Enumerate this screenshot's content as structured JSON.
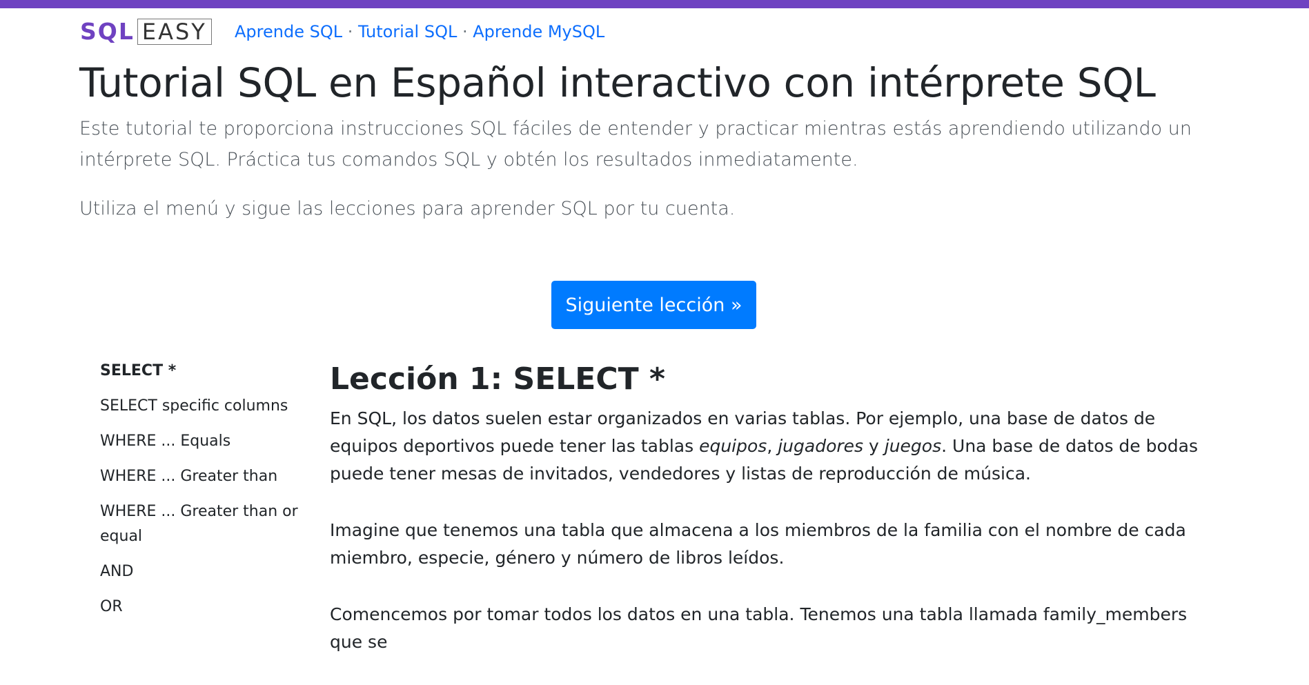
{
  "header": {
    "logo_sql": "SQL",
    "logo_easy": "EASY",
    "nav": [
      "Aprende SQL",
      "Tutorial SQL",
      "Aprende MySQL"
    ],
    "nav_separator": " · "
  },
  "hero": {
    "title": "Tutorial SQL en Español interactivo con intérprete SQL",
    "lead": "Este tutorial te proporciona instrucciones SQL fáciles de entender y practicar mientras estás aprendiendo utilizando un intérprete SQL. Práctica tus comandos SQL y obtén los resultados inmediatamente.",
    "lead2": "Utiliza el menú y sigue las lecciones para aprender SQL por tu cuenta.",
    "next_button": "Siguiente lección »"
  },
  "sidebar": {
    "items": [
      {
        "label": "SELECT *",
        "active": true
      },
      {
        "label": "SELECT specific columns",
        "active": false
      },
      {
        "label": "WHERE ... Equals",
        "active": false
      },
      {
        "label": "WHERE ... Greater than",
        "active": false
      },
      {
        "label": "WHERE ... Greater than or equal",
        "active": false
      },
      {
        "label": "AND",
        "active": false
      },
      {
        "label": "OR",
        "active": false
      }
    ]
  },
  "lesson": {
    "title": "Lección 1: SELECT *",
    "p1_a": "En SQL, los datos suelen estar organizados en varias tablas. Por ejemplo, una base de datos de equipos deportivos puede tener las tablas ",
    "p1_em1": "equipos",
    "p1_b": ", ",
    "p1_em2": "jugadores",
    "p1_c": " y ",
    "p1_em3": "juegos",
    "p1_d": ". Una base de datos de bodas puede tener mesas de invitados, vendedores y listas de reproducción de música.",
    "p2": "Imagine que tenemos una tabla que almacena a los miembros de la familia con el nombre de cada miembro, especie, género y número de libros leídos.",
    "p3": "Comencemos por tomar todos los datos en una tabla. Tenemos una tabla llamada family_members que se"
  },
  "colors": {
    "accent": "#6f42c1",
    "link": "#0d6efd",
    "button": "#007bff"
  }
}
